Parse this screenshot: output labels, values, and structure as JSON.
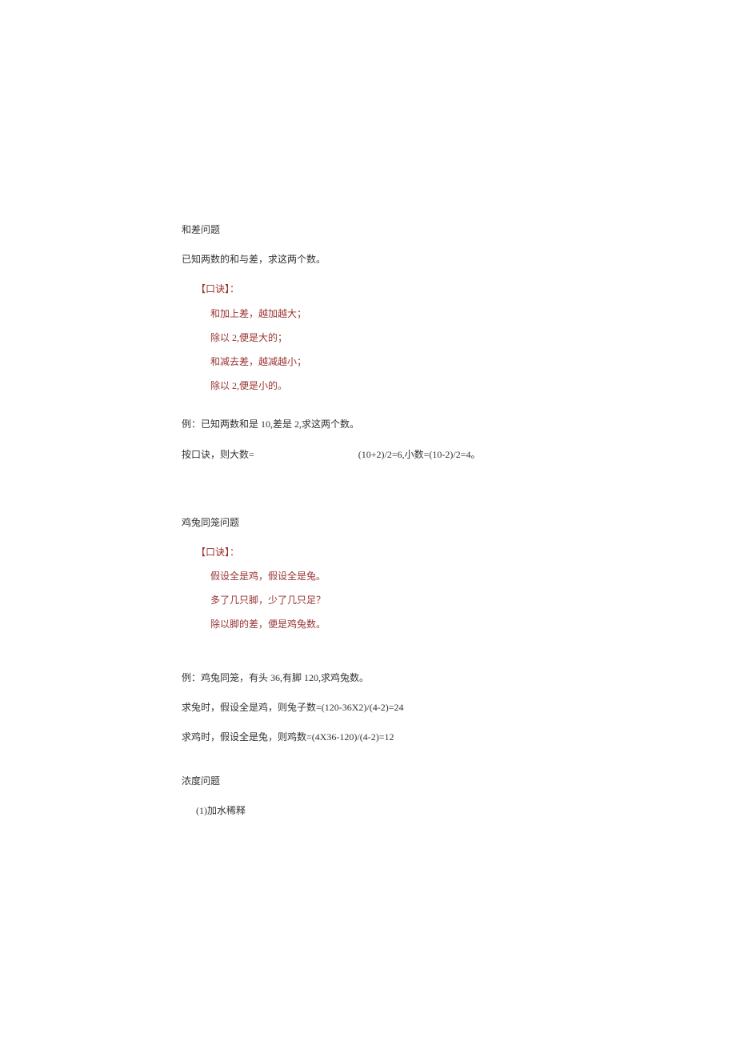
{
  "section1": {
    "title": "和差问题",
    "intro": "已知两数的和与差，求这两个数。",
    "mnemonic_label": "【口诀】：",
    "lines": [
      "和加上差，越加越大；",
      "除以 2,便是大的；",
      "和减去差，越减越小；",
      "除以 2,便是小的。"
    ],
    "example": "例：已知两数和是 10,差是 2,求这两个数。",
    "calc_left": "按口诀，则大数=",
    "calc_right": "(10+2)/2=6,小数=(10-2)/2=4。"
  },
  "section2": {
    "title": "鸡兔同笼问题",
    "mnemonic_label": "【口诀】：",
    "lines": [
      "假设全是鸡，假设全是兔。",
      "多了几只脚，少了几只足？",
      "除以脚的差，便是鸡兔数。"
    ],
    "example": "例：鸡兔同笼，有头 36,有脚 120,求鸡兔数。",
    "calc1": "求兔时，假设全是鸡，则兔子数=(120-36X2)/(4-2)=24",
    "calc2": "求鸡时，假设全是兔，则鸡数=(4X36-120)/(4-2)=12"
  },
  "section3": {
    "title": "浓度问题",
    "sub": "(1)加水稀释"
  }
}
